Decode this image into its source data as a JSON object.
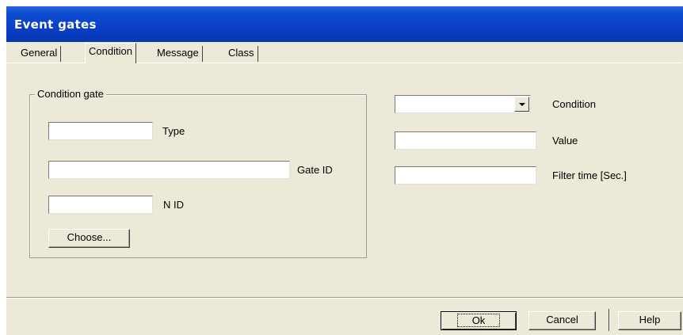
{
  "window": {
    "title": "Event gates"
  },
  "tabs": [
    {
      "label": "General",
      "active": false
    },
    {
      "label": "Condition",
      "active": true
    },
    {
      "label": "Message",
      "active": false
    },
    {
      "label": "Class",
      "active": false
    }
  ],
  "condition_gate": {
    "legend": "Condition gate",
    "type": {
      "label": "Type",
      "value": ""
    },
    "gate_id": {
      "label": "Gate ID",
      "value": ""
    },
    "n_id": {
      "label": "N ID",
      "value": ""
    },
    "choose_label": "Choose..."
  },
  "right": {
    "condition": {
      "label": "Condition",
      "value": ""
    },
    "value": {
      "label": "Value",
      "value": ""
    },
    "filter_time": {
      "label": "Filter time [Sec.]",
      "value": ""
    }
  },
  "buttons": {
    "ok": "Ok",
    "cancel": "Cancel",
    "help": "Help"
  },
  "colors": {
    "titlebar": "#0A3FC6",
    "face": "#ECE9D8"
  }
}
